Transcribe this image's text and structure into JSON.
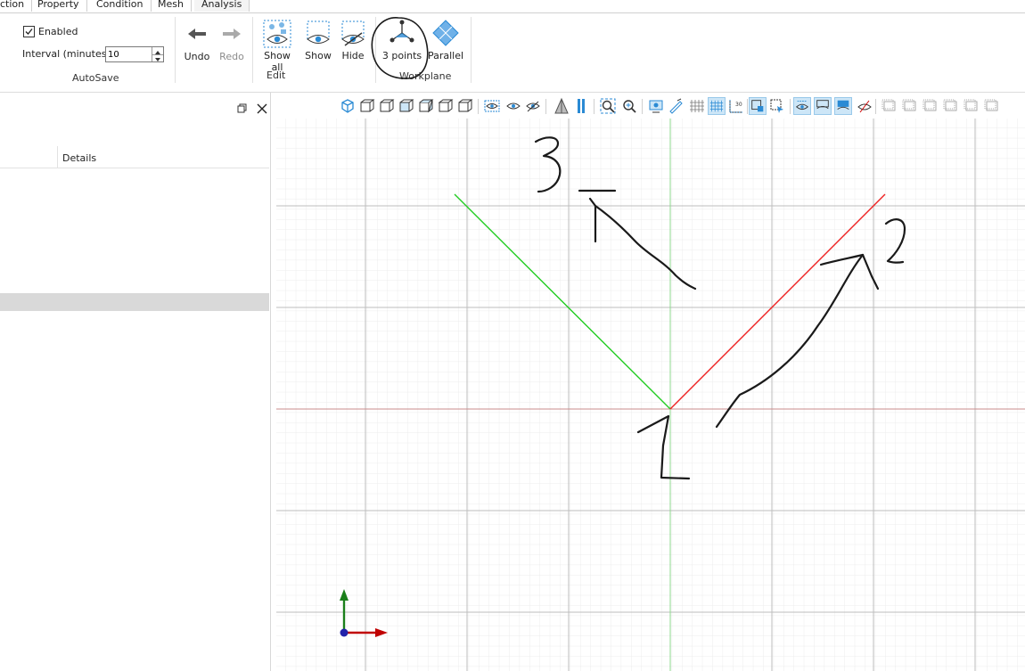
{
  "tabs": [
    "ction",
    "Property",
    "Condition",
    "Mesh",
    "Analysis"
  ],
  "autosave": {
    "enabled_label": "Enabled",
    "enabled": true,
    "interval_label": "Interval (minutes)",
    "interval_value": "10",
    "group_label": "AutoSave"
  },
  "undo_redo": {
    "undo_label": "Undo",
    "redo_label": "Redo"
  },
  "edit": {
    "show_all_label": "Show all",
    "show_label": "Show",
    "hide_label": "Hide",
    "group_label": "Edit"
  },
  "workplane": {
    "three_points_label": "3 points",
    "parallel_label": "Parallel",
    "group_label": "Workplane"
  },
  "panel": {
    "column_details": "Details"
  },
  "annotations": {
    "one": "1",
    "two": "2",
    "three": "3"
  },
  "colors": {
    "accent": "#2a8ad4",
    "x_axis": "#c00000",
    "y_axis": "#1a7f1a",
    "line_green": "#22cc22",
    "line_red": "#ee2222"
  }
}
